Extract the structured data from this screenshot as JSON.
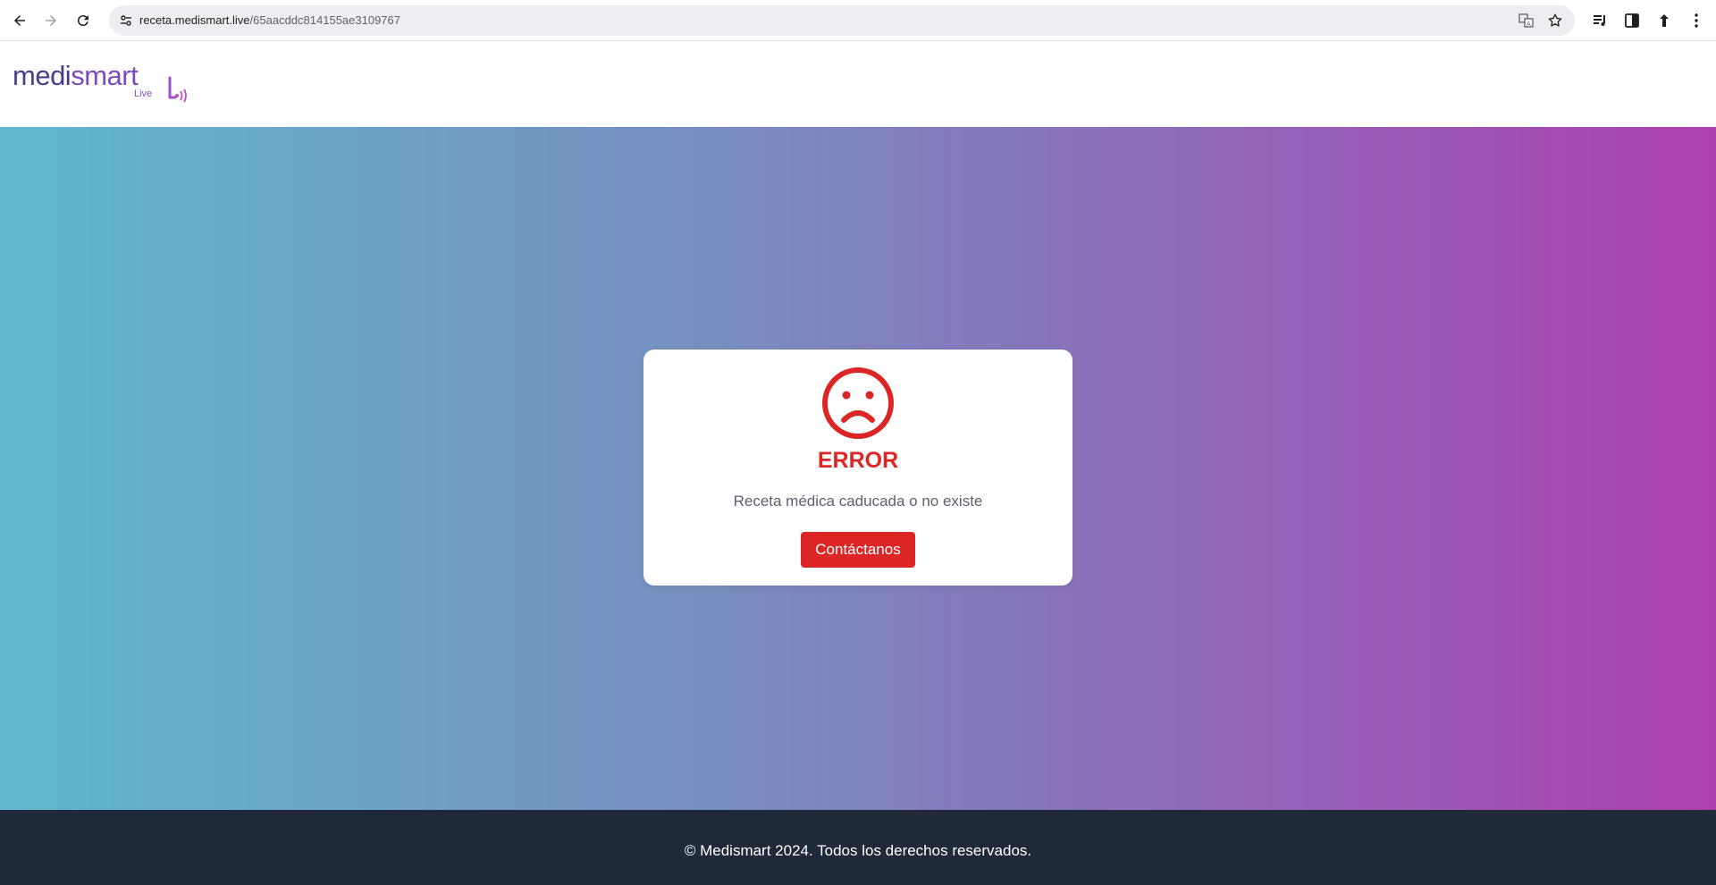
{
  "browser": {
    "url_host": "receta.medismart.live",
    "url_path": "/65aacddc814155ae3109767"
  },
  "header": {
    "logo": {
      "part1": "medi",
      "part2": "smart",
      "sub": "Live"
    }
  },
  "card": {
    "icon": "sad-face-icon",
    "title": "ERROR",
    "message": "Receta médica caducada o no existe",
    "button_label": "Contáctanos"
  },
  "footer": {
    "text": "© Medismart 2024. Todos los derechos reservados."
  },
  "colors": {
    "error_red": "#dc2626",
    "gradient_start": "#60b8cf",
    "gradient_end": "#ab42ab",
    "footer_bg": "#1f2939"
  }
}
